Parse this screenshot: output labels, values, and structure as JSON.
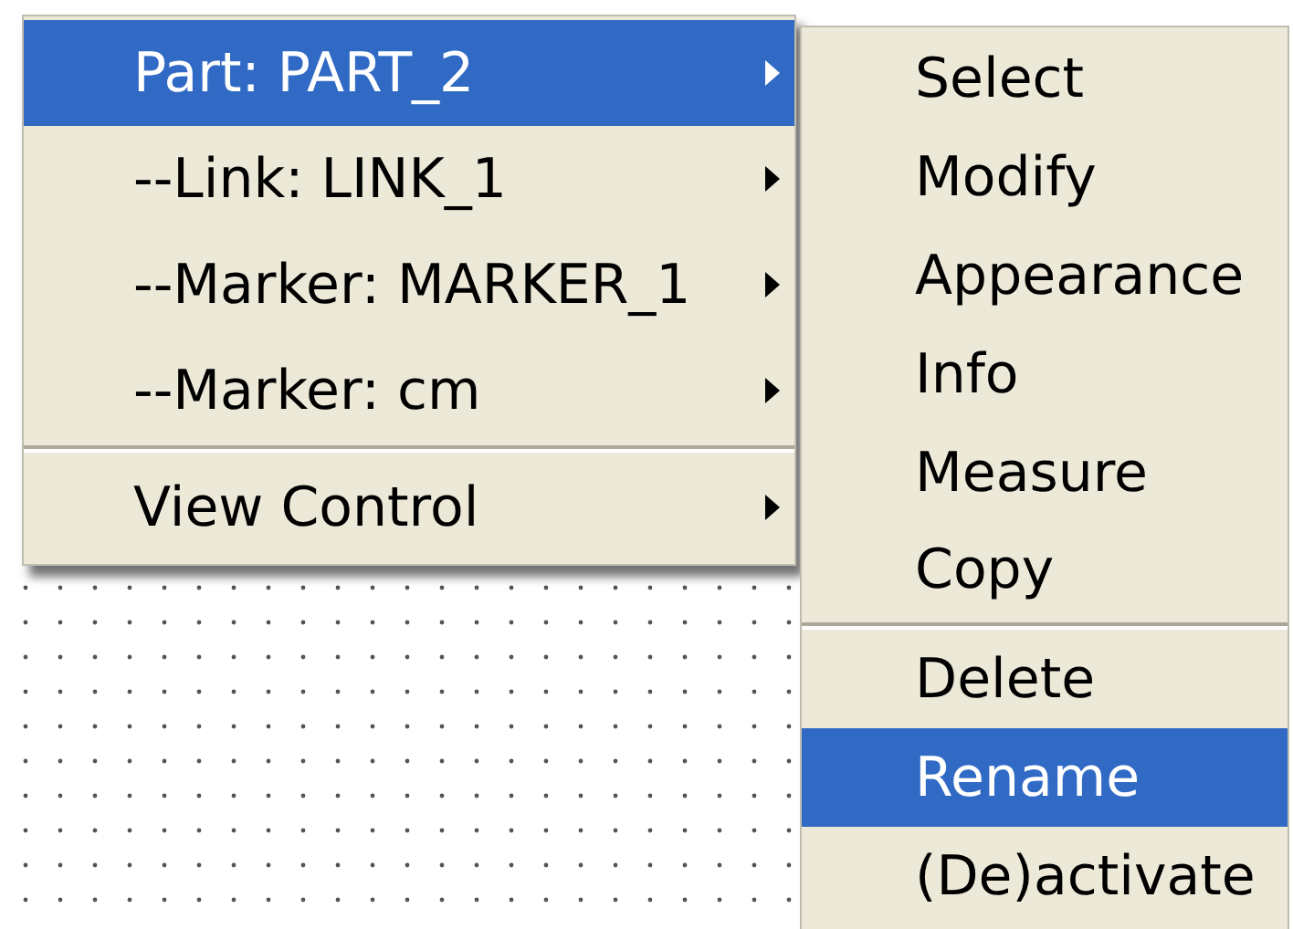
{
  "context_menu": {
    "items": [
      {
        "kind": "item",
        "label": "Part: PART_2",
        "submenu": true,
        "selected": true
      },
      {
        "kind": "item",
        "label": "--Link: LINK_1",
        "submenu": true,
        "selected": false
      },
      {
        "kind": "item",
        "label": "--Marker: MARKER_1",
        "submenu": true,
        "selected": false
      },
      {
        "kind": "item",
        "label": "--Marker: cm",
        "submenu": true,
        "selected": false
      },
      {
        "kind": "separator"
      },
      {
        "kind": "item",
        "label": "View Control",
        "submenu": true,
        "selected": false
      }
    ]
  },
  "submenu": {
    "items": [
      {
        "kind": "item",
        "label": "Select",
        "selected": false
      },
      {
        "kind": "item",
        "label": "Modify",
        "selected": false
      },
      {
        "kind": "item",
        "label": "Appearance",
        "selected": false
      },
      {
        "kind": "item",
        "label": "Info",
        "selected": false
      },
      {
        "kind": "item",
        "label": "Measure",
        "selected": false
      },
      {
        "kind": "item",
        "label": "Copy",
        "selected": false
      },
      {
        "kind": "separator"
      },
      {
        "kind": "item",
        "label": "Delete",
        "selected": false
      },
      {
        "kind": "item",
        "label": "Rename",
        "selected": true
      },
      {
        "kind": "item",
        "label": "(De)activate",
        "selected": false
      }
    ]
  }
}
